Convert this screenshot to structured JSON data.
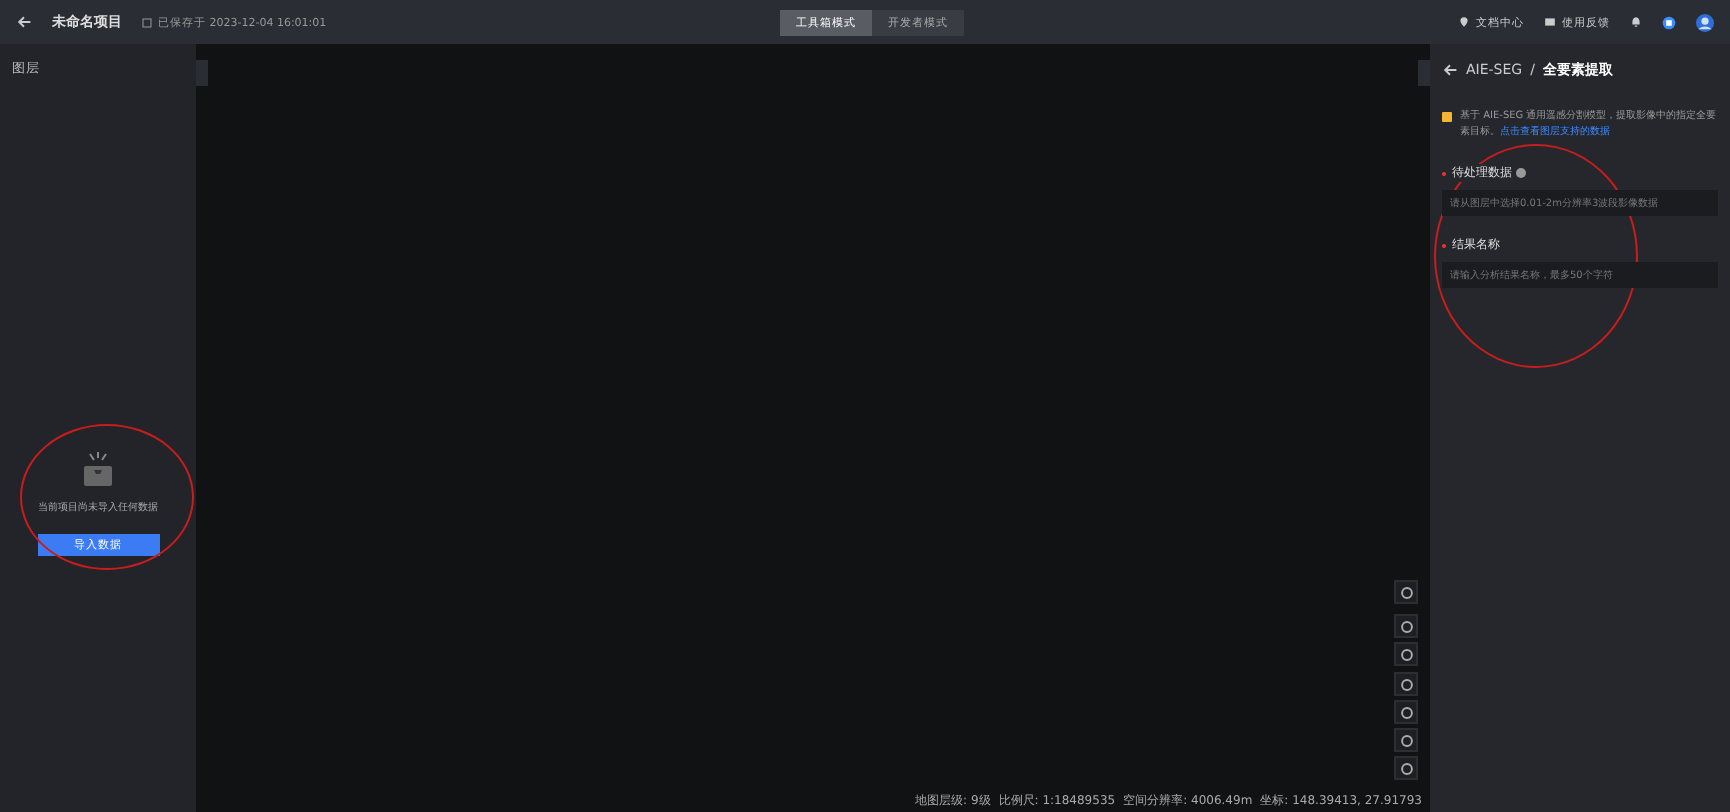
{
  "header": {
    "project_title": "未命名项目",
    "saved_text": "已保存于 2023-12-04 16:01:01",
    "modes": [
      {
        "label": "工具箱模式",
        "selected": true
      },
      {
        "label": "开发者模式",
        "selected": false
      }
    ],
    "links": [
      "文档中心",
      "使用反馈"
    ]
  },
  "left_panel": {
    "title": "图层",
    "empty_message": "当前项目尚未导入任何数据",
    "import_button": "导入数据"
  },
  "status_bar": [
    "地图层级: 9级",
    "比例尺: 1:18489535",
    "空间分辨率: 4006.49m",
    "坐标: 148.39413, 27.91793"
  ],
  "right_panel": {
    "breadcrumb": [
      "AIE-SEG",
      "全要素提取"
    ],
    "separator": "/",
    "notice": "基于 AIE-SEG 通用遥感分割模型，提取影像中的指定全要素目标。",
    "notice_link": "点击查看图层支持的数据",
    "fields": [
      {
        "label": "待处理数据",
        "required": true,
        "help": true,
        "placeholder": "请从图层中选择0.01-2m分辨率3波段影像数据"
      },
      {
        "label": "结果名称",
        "required": true,
        "help": false,
        "placeholder": "请输入分析结果名称，最多50个字符"
      }
    ]
  }
}
